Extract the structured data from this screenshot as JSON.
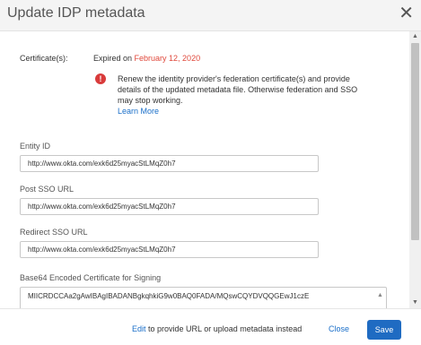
{
  "dialog": {
    "title": "Update IDP metadata"
  },
  "certificate": {
    "label": "Certificate(s):",
    "status_prefix": "Expired on ",
    "expiry_date": "February 12, 2020"
  },
  "alert": {
    "message": "Renew the identity provider's federation certificate(s) and provide details of the updated metadata file. Otherwise federation and SSO may stop working.",
    "learn_more": "Learn More"
  },
  "fields": {
    "entity_id": {
      "label": "Entity ID",
      "value": "http://www.okta.com/exk6d25myacStLMqZ0h7"
    },
    "post_sso_url": {
      "label": "Post SSO URL",
      "value": "http://www.okta.com/exk6d25myacStLMqZ0h7"
    },
    "redirect_sso_url": {
      "label": "Redirect SSO URL",
      "value": "http://www.okta.com/exk6d25myacStLMqZ0h7"
    },
    "certificate": {
      "label": "Base64 Encoded Certificate for Signing",
      "value": "MIICRDCCAa2gAwIBAgIBADANBgkqhkiG9w0BAQ0FADA/MQswCQYDVQQGEwJ1czE"
    }
  },
  "footer": {
    "edit_link": "Edit",
    "edit_suffix": " to provide URL or upload metadata instead",
    "close_label": "Close",
    "save_label": "Save"
  },
  "colors": {
    "accent": "#1f6bc2",
    "link": "#1a6fc9",
    "error": "#d93b3b"
  }
}
